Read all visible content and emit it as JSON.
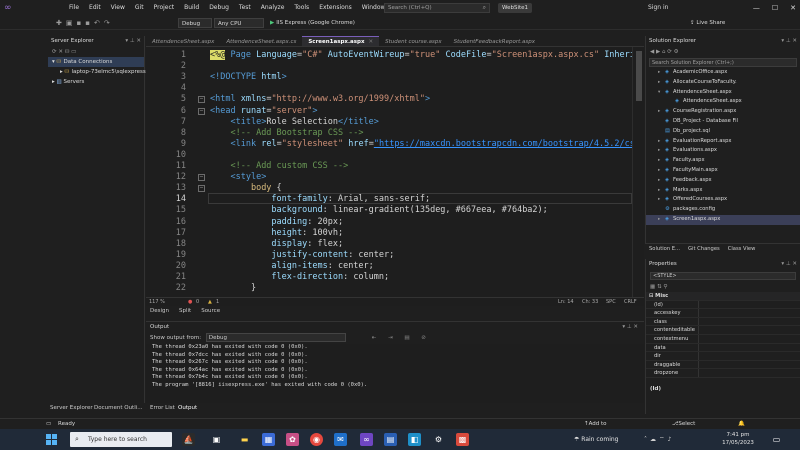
{
  "titlebar": {
    "menus": [
      "File",
      "Edit",
      "View",
      "Git",
      "Project",
      "Build",
      "Debug",
      "Test",
      "Analyze",
      "Tools",
      "Extensions",
      "Window",
      "Help"
    ],
    "search_placeholder": "Search (Ctrl+Q)",
    "solution_name": "WebSite1",
    "sign_in": "Sign in"
  },
  "toolbar": {
    "config": "Debug",
    "platform": "Any CPU",
    "run_label": "IIS Express (Google Chrome)",
    "live_share": "Live Share"
  },
  "server_explorer": {
    "title": "Server Explorer",
    "items": [
      {
        "label": "Data Connections"
      },
      {
        "label": "laptop-73elmc5\\sqlexpress"
      },
      {
        "label": "Servers"
      }
    ]
  },
  "tabs": [
    {
      "label": "AttendenceSheet.aspx"
    },
    {
      "label": "AttendenceSheet.aspx.cs"
    },
    {
      "label": "Screen1aspx.aspx",
      "active": true
    },
    {
      "label": "Student course.aspx"
    },
    {
      "label": "StudentFeedbackReport.aspx"
    }
  ],
  "editor": {
    "current_line": 14,
    "lines": [
      {
        "n": "1",
        "html": "<span class=\"asp\">&lt;%@</span> <span class=\"k\">Page</span> <span class=\"a\">Language</span>=<span class=\"s\">\"C#\"</span> <span class=\"a\">AutoEventWireup</span>=<span class=\"s\">\"true\"</span> <span class=\"a\">CodeFile</span>=<span class=\"s\">\"Screen1aspx.aspx.cs\"</span> <span class=\"a\">Inheri</span>"
      },
      {
        "n": "2",
        "html": ""
      },
      {
        "n": "3",
        "html": "<span class=\"tg\">&lt;!DOCTYPE</span> <span class=\"a\">html</span><span class=\"tg\">&gt;</span>"
      },
      {
        "n": "4",
        "html": ""
      },
      {
        "n": "5",
        "html": "<span class=\"tg\">&lt;html</span> <span class=\"a\">xmlns</span>=<span class=\"s\">\"http://www.w3.org/1999/xhtml\"</span><span class=\"tg\">&gt;</span>"
      },
      {
        "n": "6",
        "html": "<span class=\"tg\">&lt;head</span> <span class=\"a\">runat</span>=<span class=\"s\">\"server\"</span><span class=\"tg\">&gt;</span>"
      },
      {
        "n": "7",
        "html": "    <span class=\"tg\">&lt;title&gt;</span>Role Selection<span class=\"tg\">&lt;/title&gt;</span>"
      },
      {
        "n": "8",
        "html": "    <span class=\"c\">&lt;!-- Add Bootstrap CSS --&gt;</span>"
      },
      {
        "n": "9",
        "html": "    <span class=\"tg\">&lt;link</span> <span class=\"a\">rel</span>=<span class=\"s\">\"stylesheet\"</span> <span class=\"a\">href</span>=<span class=\"u\">\"https://maxcdn.bootstrapcdn.com/bootstrap/4.5.2/cs</span>"
      },
      {
        "n": "10",
        "html": ""
      },
      {
        "n": "11",
        "html": "    <span class=\"c\">&lt;!-- Add custom CSS --&gt;</span>"
      },
      {
        "n": "12",
        "html": "    <span class=\"tg\">&lt;style&gt;</span>"
      },
      {
        "n": "13",
        "html": "        <span class=\"p\">body</span> {"
      },
      {
        "n": "14",
        "html": "            <span class=\"a\">font-family</span>: Arial, sans-serif;"
      },
      {
        "n": "15",
        "html": "            <span class=\"a\">background</span>: linear-gradient(135deg, #667eea, #764ba2);"
      },
      {
        "n": "16",
        "html": "            <span class=\"a\">padding</span>: 20px;"
      },
      {
        "n": "17",
        "html": "            <span class=\"a\">height</span>: 100vh;"
      },
      {
        "n": "18",
        "html": "            <span class=\"a\">display</span>: flex;"
      },
      {
        "n": "19",
        "html": "            <span class=\"a\">justify-content</span>: center;"
      },
      {
        "n": "20",
        "html": "            <span class=\"a\">align-items</span>: center;"
      },
      {
        "n": "21",
        "html": "            <span class=\"a\">flex-direction</span>: column;"
      },
      {
        "n": "22",
        "html": "        }"
      }
    ]
  },
  "editor_status": {
    "zoom": "117 %",
    "errors": "0",
    "warnings": "1",
    "position": "Ln: 14",
    "column": "Ch: 33",
    "spc": "SPC",
    "eol": "CRLF"
  },
  "view_tabs": [
    "Design",
    "Split",
    "Source"
  ],
  "output": {
    "title": "Output",
    "show_from_label": "Show output from:",
    "source": "Debug",
    "lines": [
      "The thread 0x23a0 has exited with code 0 (0x0).",
      "The thread 0x7dcc has exited with code 0 (0x0).",
      "The thread 0x267c has exited with code 0 (0x0).",
      "The thread 0x64ac has exited with code 0 (0x0).",
      "The thread 0x7b4c has exited with code 0 (0x0).",
      "The program '[8816] iisexpress.exe' has exited with code 0 (0x0)."
    ]
  },
  "bottom_tabs": [
    "Server Explorer",
    "Document Outli...",
    "Error List",
    "Output"
  ],
  "solution_explorer": {
    "title": "Solution Explorer",
    "search_placeholder": "Search Solution Explorer (Ctrl+;)",
    "items": [
      {
        "label": "AcademicOffice.aspx",
        "exp": "▸"
      },
      {
        "label": "AllocateCourseToFaculty.",
        "exp": "▸"
      },
      {
        "label": "AttendenceSheet.aspx",
        "exp": "▾"
      },
      {
        "label": "AttendenceSheet.aspx",
        "exp": ""
      },
      {
        "label": "CourseRegistration.aspx",
        "exp": "▸"
      },
      {
        "label": "DB_Project - Database Fil",
        "exp": ""
      },
      {
        "label": "Db_project.sql",
        "exp": ""
      },
      {
        "label": "EvaluationReport.aspx",
        "exp": "▸"
      },
      {
        "label": "Evaluations.aspx",
        "exp": "▸"
      },
      {
        "label": "Faculty.aspx",
        "exp": "▸"
      },
      {
        "label": "FacultyMain.aspx",
        "exp": "▸"
      },
      {
        "label": "Feedback.aspx",
        "exp": "▸"
      },
      {
        "label": "Marks.aspx",
        "exp": "▸"
      },
      {
        "label": "OfferedCourses.aspx",
        "exp": "▸"
      },
      {
        "label": "packages.config",
        "exp": ""
      },
      {
        "label": "Screen1aspx.aspx",
        "exp": "▸"
      }
    ],
    "tabs": [
      "Solution E...",
      "Git Changes",
      "Class View"
    ]
  },
  "properties": {
    "title": "Properties",
    "object": "<STYLE>",
    "category": "Misc",
    "rows": [
      {
        "name": "(Id)",
        "value": ""
      },
      {
        "name": "accesskey",
        "value": ""
      },
      {
        "name": "class",
        "value": ""
      },
      {
        "name": "contenteditable",
        "value": ""
      },
      {
        "name": "contextmenu",
        "value": ""
      },
      {
        "name": "data",
        "value": ""
      },
      {
        "name": "dir",
        "value": ""
      },
      {
        "name": "draggable",
        "value": ""
      },
      {
        "name": "dropzone",
        "value": ""
      }
    ],
    "footer": "(Id)"
  },
  "statusbar": {
    "ready": "Ready",
    "source_control": "Add to Source Control",
    "repository": "Select Repository"
  },
  "taskbar": {
    "search_placeholder": "Type here to search",
    "weather": "Rain coming",
    "time": "7:41 pm",
    "date": "17/05/2023"
  }
}
